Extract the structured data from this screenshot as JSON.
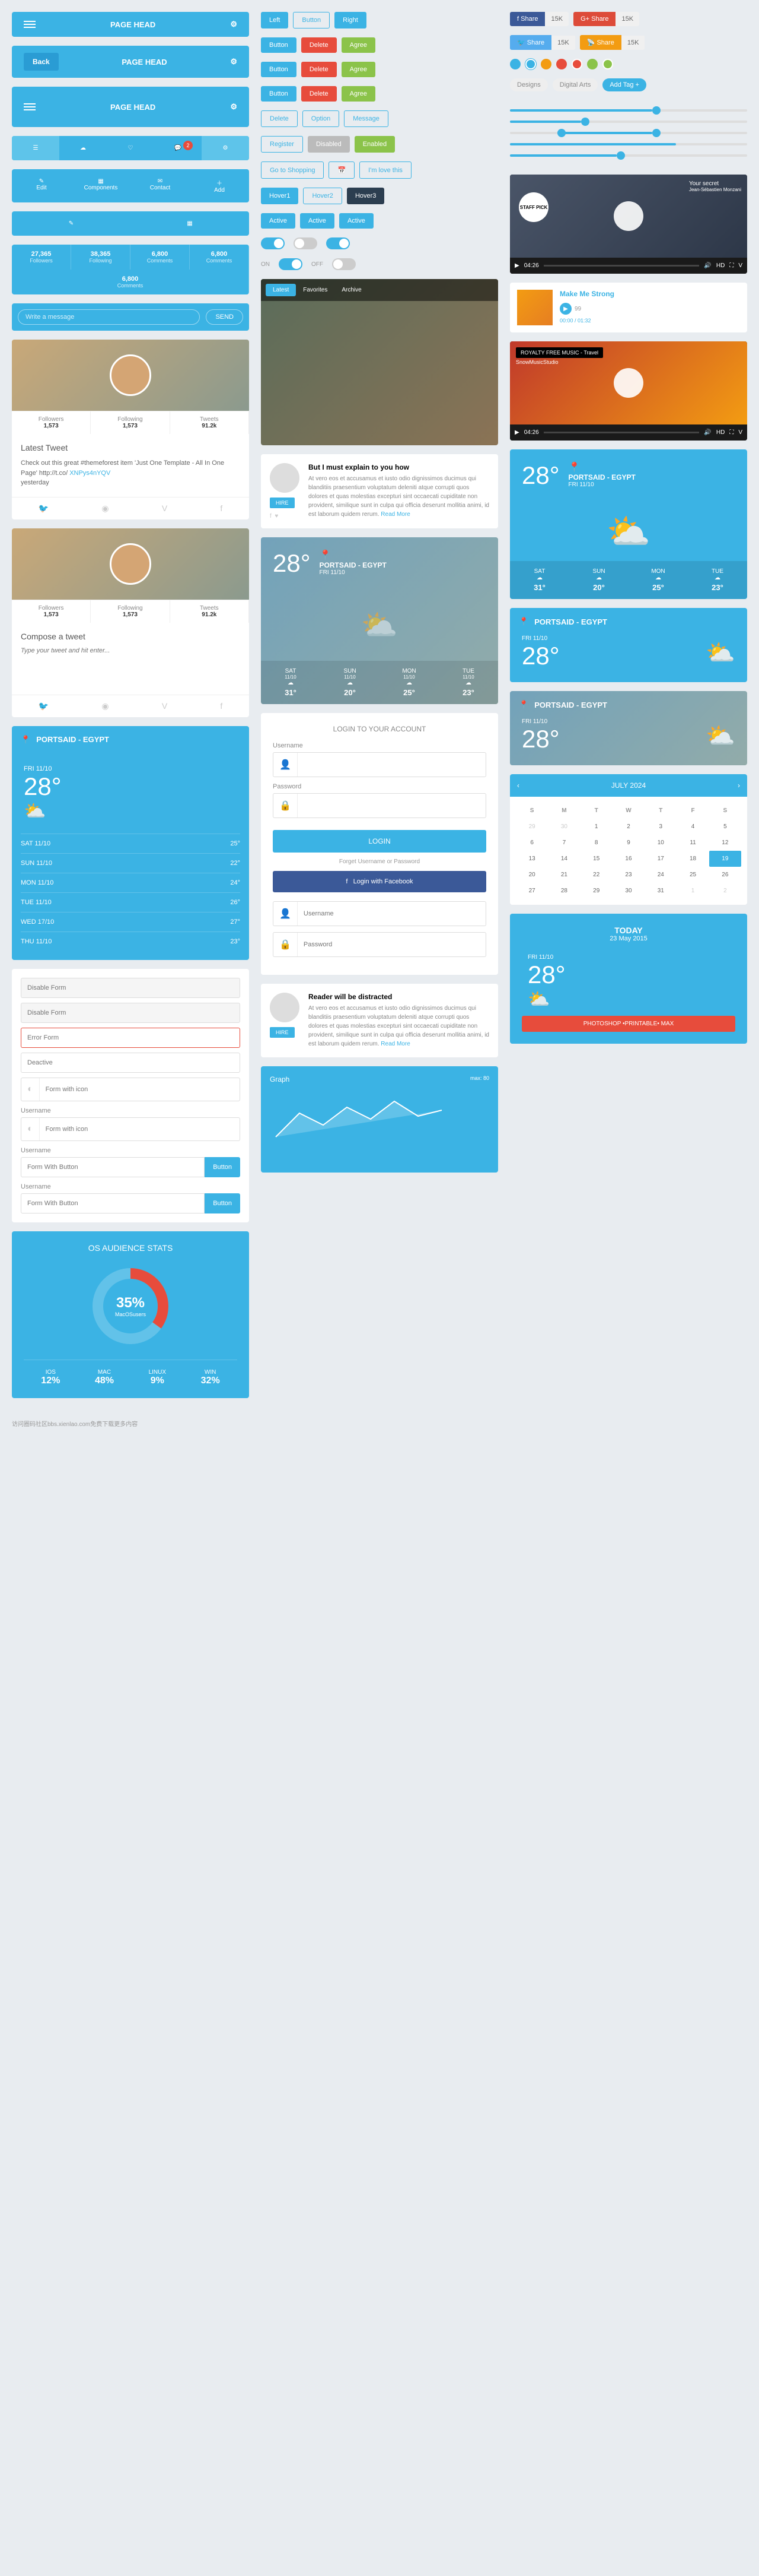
{
  "headers": {
    "pageHead": "PAGE HEAD",
    "back": "Back"
  },
  "tabs": {
    "edit": "Edit",
    "components": "Components",
    "contact": "Contact",
    "add": "Add",
    "badge": "2"
  },
  "stats": [
    {
      "num": "27,365",
      "lbl": "Followers"
    },
    {
      "num": "38,365",
      "lbl": "Following"
    },
    {
      "num": "6,800",
      "lbl": "Comments"
    },
    {
      "num": "6,800",
      "lbl": "Comments"
    },
    {
      "num": "6,800",
      "lbl": "Comments"
    }
  ],
  "msg": {
    "placeholder": "Write a message",
    "send": "SEND"
  },
  "profile": {
    "stats": [
      {
        "lbl": "Followers",
        "num": "1,573"
      },
      {
        "lbl": "Following",
        "num": "1,573"
      },
      {
        "lbl": "Tweets",
        "num": "91.2k"
      }
    ]
  },
  "tweet": {
    "title": "Latest Tweet",
    "text": "Check out this great #themeforest item 'Just One Template - All In One Page' http://t.co/",
    "link": "XNPys4nYQV",
    "time": "yesterday",
    "compose": "Compose a tweet",
    "placeholder": "Type your tweet and hit enter..."
  },
  "weather": {
    "location": "PORTSAID - EGYPT",
    "date": "FRI 11/10",
    "temp": "28°",
    "forecast": [
      {
        "day": "SAT 11/10",
        "temp": "25°"
      },
      {
        "day": "SUN 11/10",
        "temp": "22°"
      },
      {
        "day": "MON 11/10",
        "temp": "24°"
      },
      {
        "day": "TUE 11/10",
        "temp": "26°"
      },
      {
        "day": "WED 17/10",
        "temp": "27°"
      },
      {
        "day": "THU 11/10",
        "temp": "23°"
      }
    ],
    "days": [
      {
        "name": "SAT",
        "sub": "11/10",
        "temp": "31°"
      },
      {
        "name": "SUN",
        "sub": "11/10",
        "temp": "20°"
      },
      {
        "name": "MON",
        "sub": "11/10",
        "temp": "25°"
      },
      {
        "name": "TUE",
        "sub": "11/10",
        "temp": "23°"
      }
    ]
  },
  "buttons": {
    "left": "Left",
    "button": "Button",
    "right": "Right",
    "delete": "Delete",
    "agree": "Agree",
    "option": "Option",
    "message": "Message",
    "register": "Register",
    "disabled": "Disabled",
    "enabled": "Enabled",
    "shopping": "Go to Shopping",
    "love": "I'm love this",
    "hover1": "Hover1",
    "hover2": "Hover2",
    "hover3": "Hover3",
    "active": "Active"
  },
  "toggles": {
    "on": "ON",
    "off": "OFF"
  },
  "gallery": {
    "latest": "Latest",
    "favorites": "Favorites",
    "archive": "Archive"
  },
  "article": {
    "title": "But I must explain to you how",
    "text": "At vero eos et accusamus et iusto odio dignissimos ducimus qui blanditiis praesentium voluptatum deleniti atque corrupti quos dolores et quas molestias excepturi sint occaecati cupiditate non provident, similique sunt in culpa qui officia deserunt mollitia animi, id est laborum quidem rerum.",
    "more": "Read More",
    "hire": "HIRE",
    "title2": "Reader will be distracted"
  },
  "share": {
    "share": "Share",
    "count": "15K"
  },
  "tags": {
    "designs": "Designs",
    "digital": "Digital Arts",
    "add": "Add Tag"
  },
  "video": {
    "title1": "Your secret",
    "author1": "Jean-Sébastien Monzani",
    "staff": "STAFF PICK",
    "time": "04:26",
    "title2": "ROYALTY FREE MUSIC - Travel",
    "author2": "SnowMusicStudio"
  },
  "audio": {
    "title": "Make Me Strong",
    "time": "00:00 / 01:32",
    "count": "99"
  },
  "forms": {
    "disable": "Disable Form",
    "error": "Error Form",
    "deactive": "Deactive",
    "withIcon": "Form with icon",
    "withButton": "Form With Button",
    "username": "Username",
    "button": "Button"
  },
  "donut": {
    "title": "OS AUDIENCE STATS",
    "pct": "35%",
    "sub": "MacOSusers",
    "os": [
      {
        "name": "IOS",
        "pct": "12%"
      },
      {
        "name": "MAC",
        "pct": "48%"
      },
      {
        "name": "LINUX",
        "pct": "9%"
      },
      {
        "name": "WIN",
        "pct": "32%"
      }
    ]
  },
  "login": {
    "title": "LOGIN TO YOUR ACCOUNT",
    "username": "Username",
    "password": "Password",
    "btn": "LOGIN",
    "forgot": "Forget Username or Password",
    "fb": "Login with Facebook"
  },
  "calendar": {
    "month": "JULY 2024",
    "days": [
      "S",
      "M",
      "T",
      "W",
      "T",
      "F",
      "S"
    ],
    "active": "19"
  },
  "today": {
    "title": "TODAY",
    "date": "23 May 2015"
  },
  "graph": {
    "title": "Graph",
    "max": "max: 80"
  },
  "banner": "PHOTOSHOP •PRINTABLE• MAX",
  "footer": "访问圈码社区bbs.xienlao.com免费下载更多内容"
}
